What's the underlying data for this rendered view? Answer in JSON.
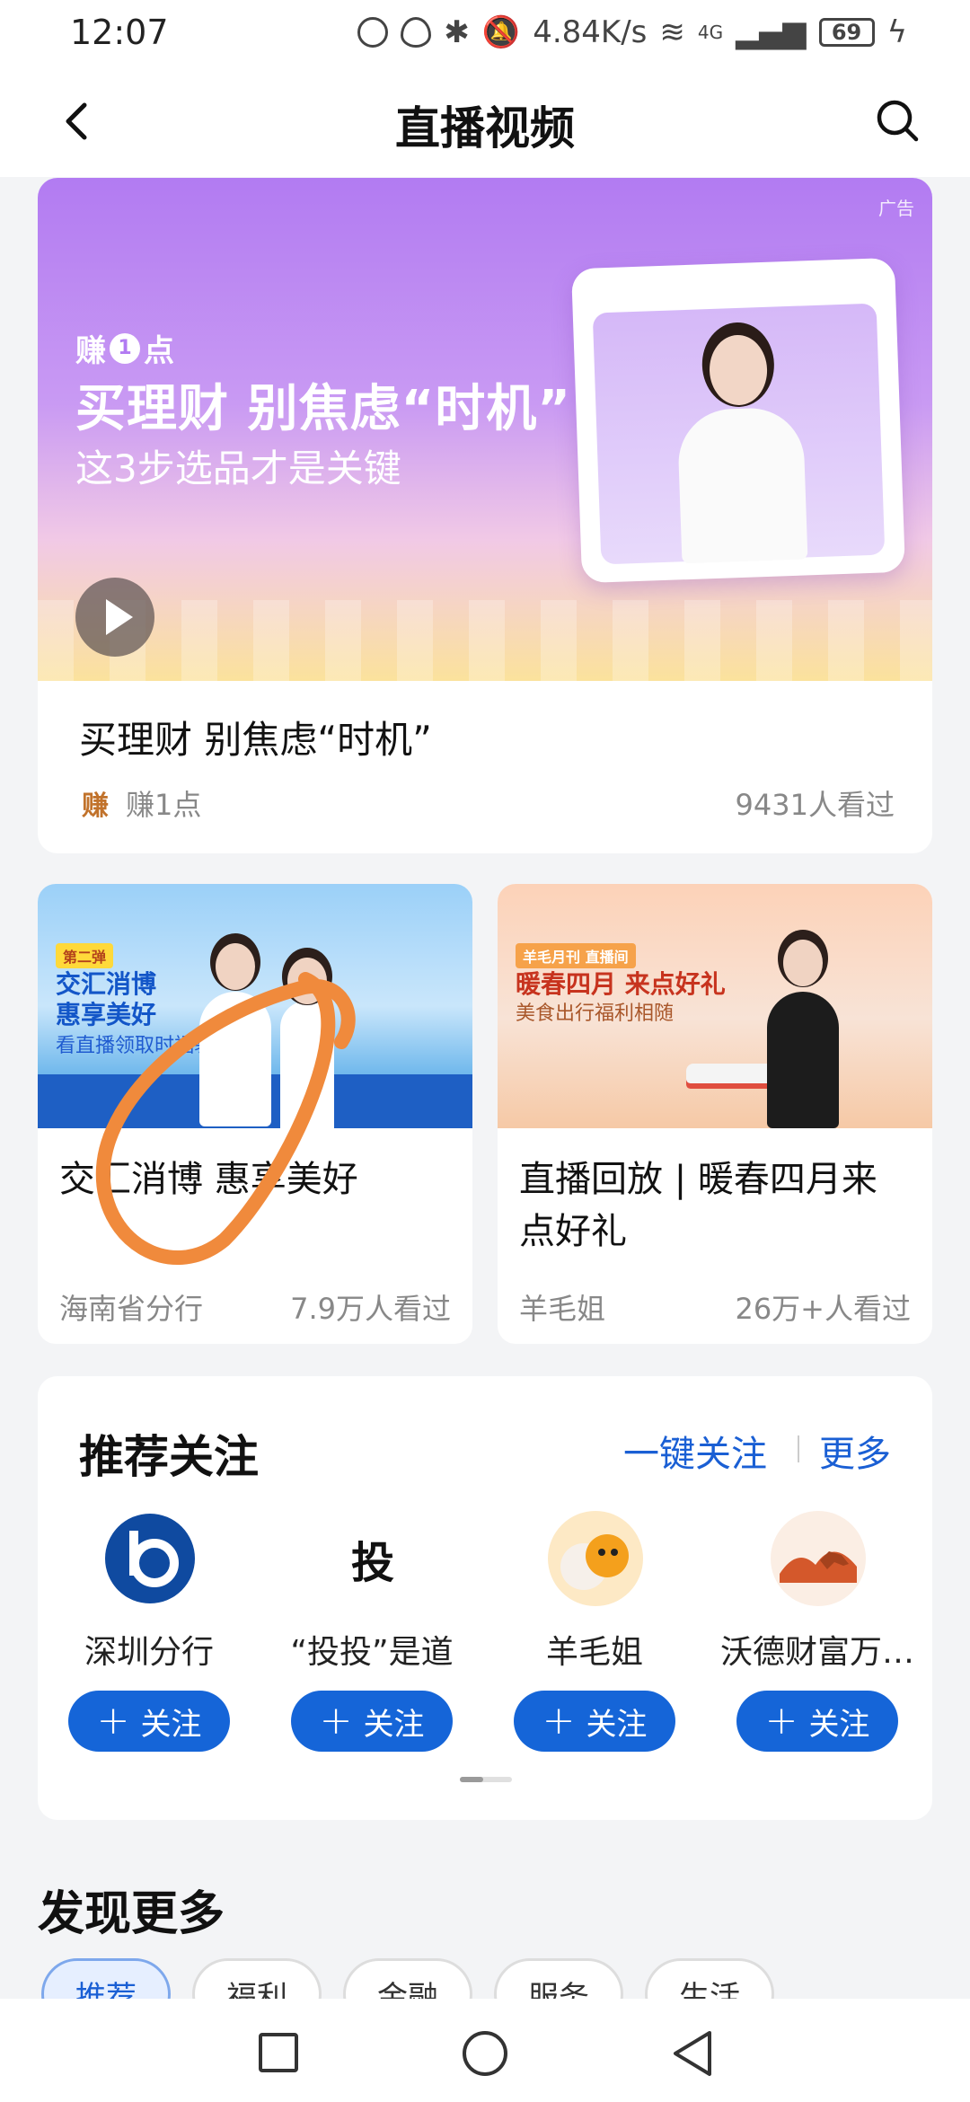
{
  "status_bar": {
    "time": "12:07",
    "net_speed": "4.84K/s",
    "network": "4G",
    "battery": "69"
  },
  "header": {
    "title": "直播视频"
  },
  "featured": {
    "ad_label": "广告",
    "banner_brand_a": "赚",
    "banner_brand_num": "1",
    "banner_brand_b": "点",
    "banner_headline": "买理财 别焦虑“时机”",
    "banner_subline": "这3步选品才是关键",
    "title": "买理财 别焦虑“时机”",
    "source_logo": "赚",
    "source": "赚1点",
    "views": "9431人看过"
  },
  "cards": [
    {
      "thumb_tag": "第二弹",
      "thumb_line1": "交汇消博",
      "thumb_line2": "惠享美好",
      "thumb_line3": "看直播领取时福袋",
      "title": "交汇消博 惠享美好",
      "source": "海南省分行",
      "views": "7.9万人看过"
    },
    {
      "thumb_tag": "羊毛月刊 直播间",
      "thumb_line1": "暖春四月 来点好礼",
      "thumb_line3": "美食出行福利相随",
      "title": "直播回放 | 暖春四月来点好礼",
      "source": "羊毛姐",
      "views": "26万+人看过"
    }
  ],
  "recommend": {
    "title": "推荐关注",
    "follow_all": "一键关注",
    "more": "更多",
    "follow_label": "关注",
    "accounts": [
      {
        "name": "深圳分行",
        "icon": "bank-logo-icon"
      },
      {
        "name": "“投投”是道",
        "icon": "tou-logo-icon"
      },
      {
        "name": "羊毛姐",
        "icon": "lamb-mascot-icon"
      },
      {
        "name": "沃德财富万…",
        "icon": "horse-logo-icon"
      }
    ]
  },
  "discover": {
    "title": "发现更多",
    "chips": [
      "推荐",
      "福利",
      "金融",
      "服务",
      "生活"
    ]
  },
  "colors": {
    "accent": "#1565d8",
    "annotation": "#f08a3c"
  }
}
